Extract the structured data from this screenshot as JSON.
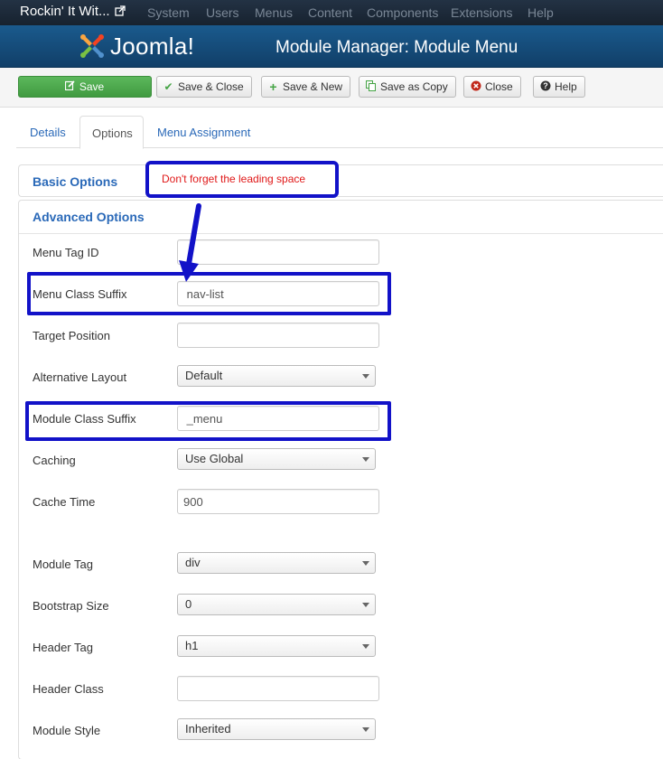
{
  "topnav": {
    "site_title": "Rockin' It Wit...",
    "menu": [
      "System",
      "Users",
      "Menus",
      "Content",
      "Components",
      "Extensions",
      "Help"
    ]
  },
  "header": {
    "logo_text": "Joomla!",
    "title": "Module Manager: Module Menu"
  },
  "toolbar": {
    "save": "Save",
    "save_close": "Save & Close",
    "save_new": "Save & New",
    "save_copy": "Save as Copy",
    "close": "Close",
    "help": "Help"
  },
  "tabs": [
    "Details",
    "Options",
    "Menu Assignment"
  ],
  "active_tab": "Options",
  "sections": {
    "basic": "Basic Options",
    "advanced": "Advanced Options"
  },
  "callout": "Don't forget the leading space",
  "form": {
    "menu_tag_id": {
      "label": "Menu Tag ID",
      "value": ""
    },
    "menu_class_suffix": {
      "label": "Menu Class Suffix",
      "value": " nav-list"
    },
    "target_position": {
      "label": "Target Position",
      "value": ""
    },
    "alternative_layout": {
      "label": "Alternative Layout",
      "value": "Default"
    },
    "module_class_suffix": {
      "label": "Module Class Suffix",
      "value": " _menu"
    },
    "caching": {
      "label": "Caching",
      "value": "Use Global"
    },
    "cache_time": {
      "label": "Cache Time",
      "value": "900"
    },
    "module_tag": {
      "label": "Module Tag",
      "value": "div"
    },
    "bootstrap_size": {
      "label": "Bootstrap Size",
      "value": "0"
    },
    "header_tag": {
      "label": "Header Tag",
      "value": "h1"
    },
    "header_class": {
      "label": "Header Class",
      "value": ""
    },
    "module_style": {
      "label": "Module Style",
      "value": "Inherited"
    }
  },
  "colors": {
    "navbar": "#1b2a3a",
    "header": "#155081",
    "save_button": "#51a351",
    "link": "#2a69b8",
    "annotation_box": "#1212c8",
    "annotation_text": "#e01818"
  },
  "icons": {
    "site_external": "external-link-icon",
    "save": "edit-icon",
    "save_close": "check-icon",
    "save_new": "plus-icon",
    "save_copy": "copy-icon",
    "close": "close-circle-icon",
    "help": "help-circle-icon"
  }
}
